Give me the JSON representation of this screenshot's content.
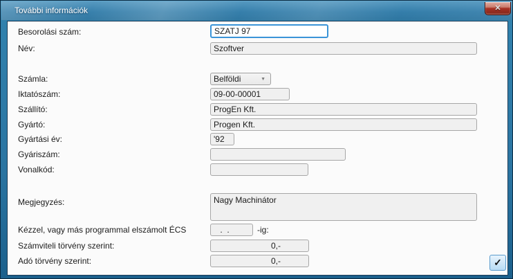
{
  "window": {
    "title": "További információk"
  },
  "icons": {
    "close": "✕",
    "dropdown_arrow": "▼",
    "confirm_check": "✓"
  },
  "form": {
    "besorolasi_szam": {
      "label": "Besorolási szám:",
      "value": "SZATJ 97"
    },
    "nev": {
      "label": "Név:",
      "value": "Szoftver"
    },
    "szamla": {
      "label": "Számla:",
      "value": "Belföldi"
    },
    "iktatoszam": {
      "label": "Iktatószám:",
      "value": "09-00-00001"
    },
    "szallito": {
      "label": "Szállító:",
      "value": "ProgEn Kft."
    },
    "gyarto": {
      "label": "Gyártó:",
      "value": "Progen Kft."
    },
    "gyartasi_ev": {
      "label": "Gyártási év:",
      "value": "'92"
    },
    "gyariszam": {
      "label": "Gyáriszám:",
      "value": ""
    },
    "vonalkod": {
      "label": "Vonalkód:",
      "value": ""
    },
    "megjegyzes": {
      "label": "Megjegyzés:",
      "value": "Nagy Machinátor"
    },
    "ecs": {
      "label": "Kézzel, vagy más programmal elszámolt ÉCS",
      "value": " .  . ",
      "suffix": "-ig:"
    },
    "szamviteli": {
      "label": "Számviteli törvény szerint:",
      "value": "0,-"
    },
    "ado": {
      "label": "Adó törvény szerint:",
      "value": "0,-"
    }
  },
  "colors": {
    "titlebar_blue": "#2e7ba9",
    "close_red": "#a83225",
    "focus_border": "#3a94d8",
    "input_bg": "#f0f0f0",
    "confirm_bg": "#cfe7f8",
    "confirm_border": "#5a9bcd"
  }
}
